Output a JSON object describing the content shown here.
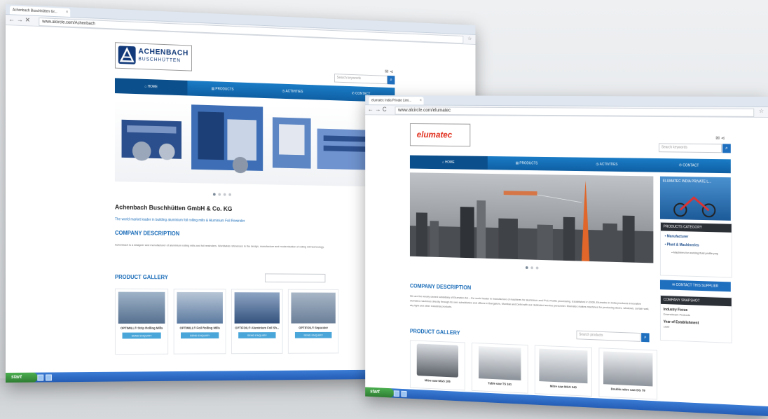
{
  "window1": {
    "tab_title": "Achenbach Buschhütten Gr...",
    "url": "www.alcircle.com/Achenbach",
    "logo_line1": "ACHENBACH",
    "logo_line2": "BUSCHHÜTTEN",
    "nav": [
      "HOME",
      "PRODUCTS",
      "ACTIVITIES",
      "CONTACT"
    ],
    "search_placeholder": "Search keywords",
    "company_name": "Achenbach Buschhütten GmbH & Co. KG",
    "tagline": "The world market leader in building aluminium foil rolling mills & Aluminium Foil Rewinder",
    "company_desc_title": "COMPANY DESCRIPTION",
    "company_desc_text": "Achenbach is a designer and manufacturer of aluminium rolling mills and foil rewinders. Worldwide references in the design, manufacture and modernisation of rolling mill technology.",
    "gallery_title": "PRODUCT GALLERY",
    "products": [
      {
        "name": "OPTIMILL® Strip Rolling Mills",
        "button": "SEND ENQUIRY"
      },
      {
        "name": "OPTIMILL® Foil Rolling Mills",
        "button": "SEND ENQUIRY"
      },
      {
        "name": "OPTIFOIL® Aluminium Foil Sh...",
        "button": "SEND ENQUIRY"
      },
      {
        "name": "OPTIFOIL® Separator",
        "button": "SEND ENQUIRY"
      }
    ],
    "taskbar_start": "start"
  },
  "window2": {
    "tab_title": "elumatec India Private Limi...",
    "url": "www.alcircle.com/elumatec",
    "logo_text": "elumatec",
    "nav": [
      "HOME",
      "PRODUCTS",
      "ACTIVITIES",
      "CONTACT"
    ],
    "search_placeholder": "Search keywords",
    "banner_title": "ELUMATEC INDIA PRIVATE L...",
    "products_category_title": "PRODUCTS CATEGORY",
    "categories": [
      "Manufacturer",
      "Plant & Machineries",
      "Machines for working fluid profile pvg"
    ],
    "contact_button": "CONTACT THIS SUPPLIER",
    "snapshot_title": "COMPANY SNAPSHOT",
    "snapshot": [
      {
        "label": "Industry Focus",
        "value": "Downstream Products"
      },
      {
        "label": "Year of Establishment",
        "value": "1920"
      }
    ],
    "company_desc_title": "COMPANY DESCRIPTION",
    "company_desc_text": "We are the wholly owned subsidiary of Elumatec AG – the world leader in manufacture of machines for aluminium and PVC Profile processing. Established in 2006, Elumatec in India produces innovative elumatec machines directly through its own subsidiaries and offices in Bangalore, Mumbai and Delhi with our dedicated service personnel. Elumatec makes machines for producing doors, windows, curtain wall, sky light and other industrial products.",
    "gallery_title": "PRODUCT GALLERY",
    "gallery_search_placeholder": "Search products",
    "products": [
      {
        "name": "Mitre saw MGS 105"
      },
      {
        "name": "Table saw TS 161"
      },
      {
        "name": "Mitre saw MGS 240"
      },
      {
        "name": "Double mitre saw DG 79"
      }
    ],
    "taskbar_start": "start"
  }
}
